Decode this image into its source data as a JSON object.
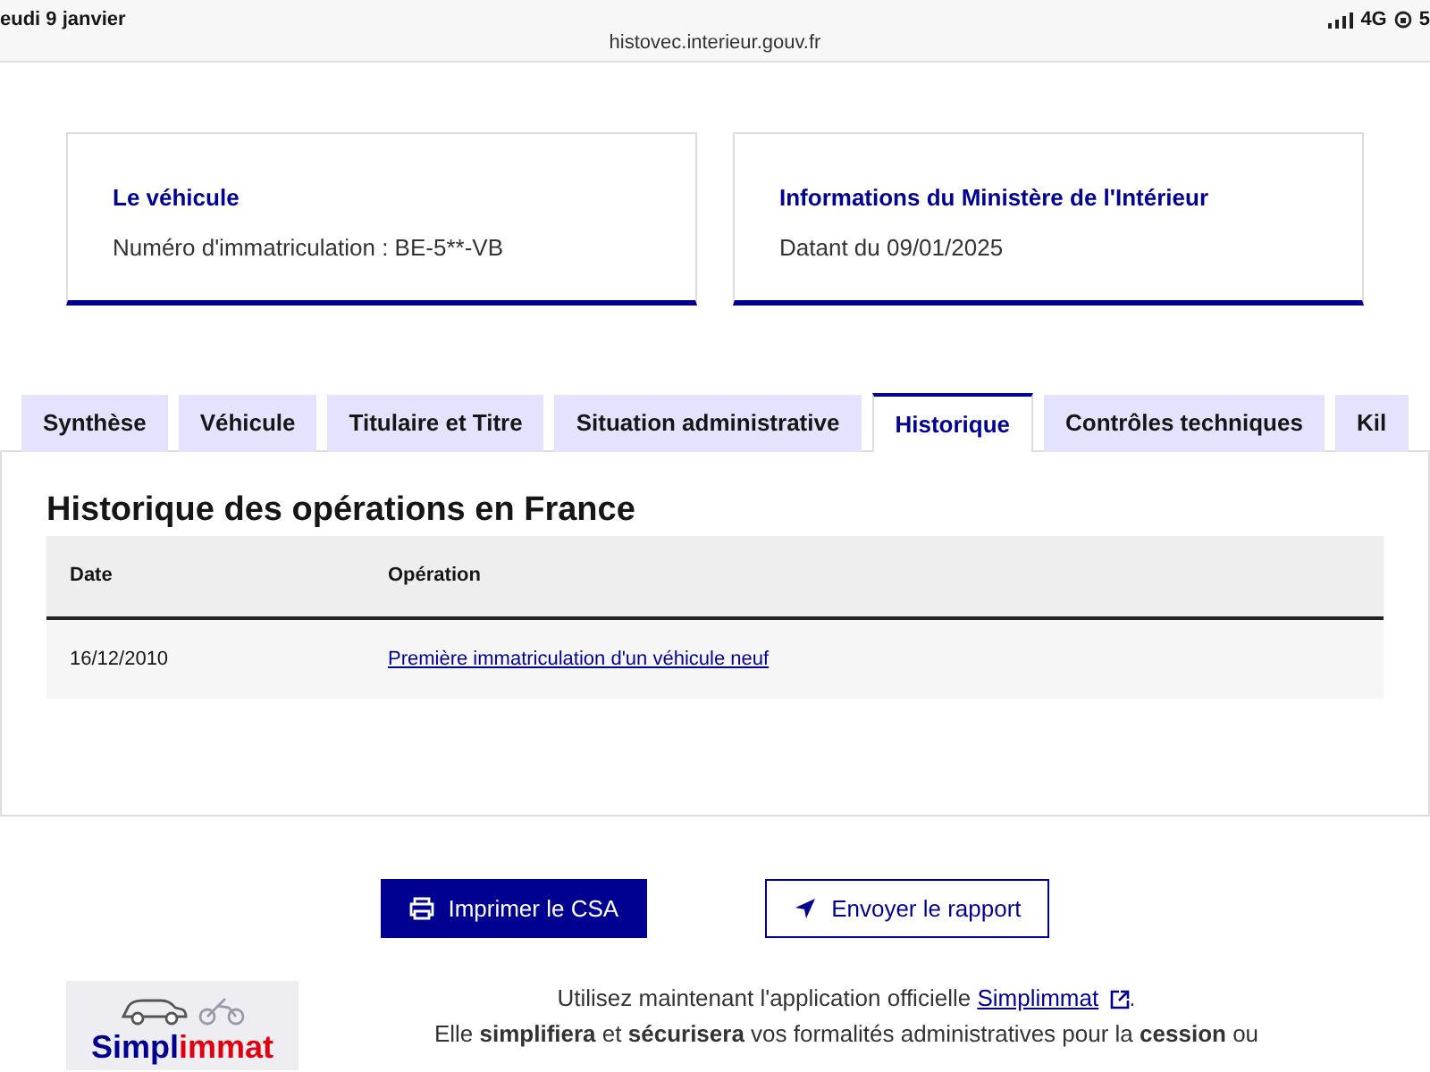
{
  "status_bar": {
    "date": "eudi 9 janvier",
    "url": "histovec.interieur.gouv.fr",
    "network": "4G",
    "battery": "5"
  },
  "cards": [
    {
      "title": "Le véhicule",
      "text": "Numéro d'immatriculation : BE-5**-VB"
    },
    {
      "title": "Informations du Ministère de l'Intérieur",
      "text": "Datant du 09/01/2025"
    }
  ],
  "tabs": [
    {
      "label": "Synthèse",
      "selected": false
    },
    {
      "label": "Véhicule",
      "selected": false
    },
    {
      "label": "Titulaire et Titre",
      "selected": false
    },
    {
      "label": "Situation administrative",
      "selected": false
    },
    {
      "label": "Historique",
      "selected": true
    },
    {
      "label": "Contrôles techniques",
      "selected": false
    },
    {
      "label": "Kil",
      "selected": false
    }
  ],
  "section_title": "Historique des opérations en France",
  "table": {
    "columns": [
      "Date",
      "Opération"
    ],
    "rows": [
      [
        "16/12/2010",
        "Première immatriculation d'un véhicule neuf"
      ]
    ]
  },
  "buttons": [
    {
      "kind": "primary",
      "label": "Imprimer le CSA"
    },
    {
      "kind": "secondary",
      "label": "Envoyer le rapport"
    }
  ],
  "promo": {
    "logo_left": "Simpl",
    "logo_right": "immat",
    "line_1_before": "Utilisez maintenant l'application officielle",
    "link": "Simplimmat",
    "line_1_after": ".",
    "line_2": "Elle **simplifiera** et **sécurisera** vos formalités administratives pour la **cession** ou"
  }
}
